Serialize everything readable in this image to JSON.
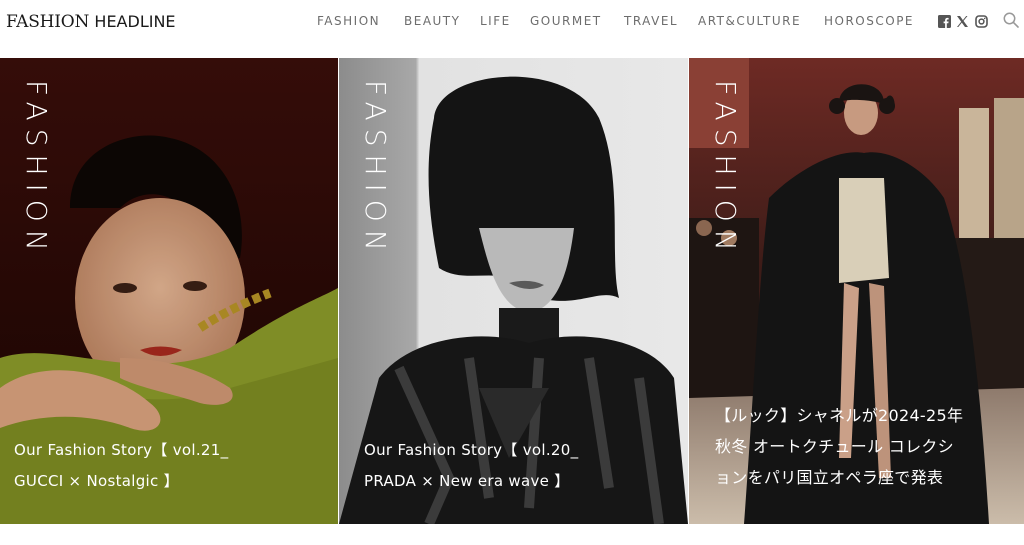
{
  "header": {
    "logo_part1": "FASHION ",
    "logo_part2": "HEADLINE",
    "nav": [
      {
        "label": "FASHION"
      },
      {
        "label": "BEAUTY"
      },
      {
        "label": "LIFE"
      },
      {
        "label": "GOURMET"
      },
      {
        "label": "TRAVEL"
      },
      {
        "label": "ART&CULTURE"
      },
      {
        "label": "HOROSCOPE"
      }
    ],
    "social_icons": [
      "facebook-icon",
      "x-icon",
      "instagram-icon"
    ],
    "search_icon": "search-icon"
  },
  "cards": [
    {
      "category": "FASHION",
      "title_lines": [
        "Our Fashion Story【 vol.21_",
        "GUCCI × Nostalgic 】"
      ]
    },
    {
      "category": "FASHION",
      "title_lines": [
        "Our Fashion Story【 vol.20_",
        "PRADA × New era wave 】"
      ]
    },
    {
      "category": "FASHION",
      "title_lines": [
        "【ルック】シャネルが2024-25年",
        "秋冬 オートクチュール コレクシ",
        "ョンをパリ国立オペラ座で発表"
      ]
    }
  ],
  "colors": {
    "nav_text": "#6d6d6d",
    "logo_text": "#1a1a1a",
    "card_text": "#ffffff"
  }
}
